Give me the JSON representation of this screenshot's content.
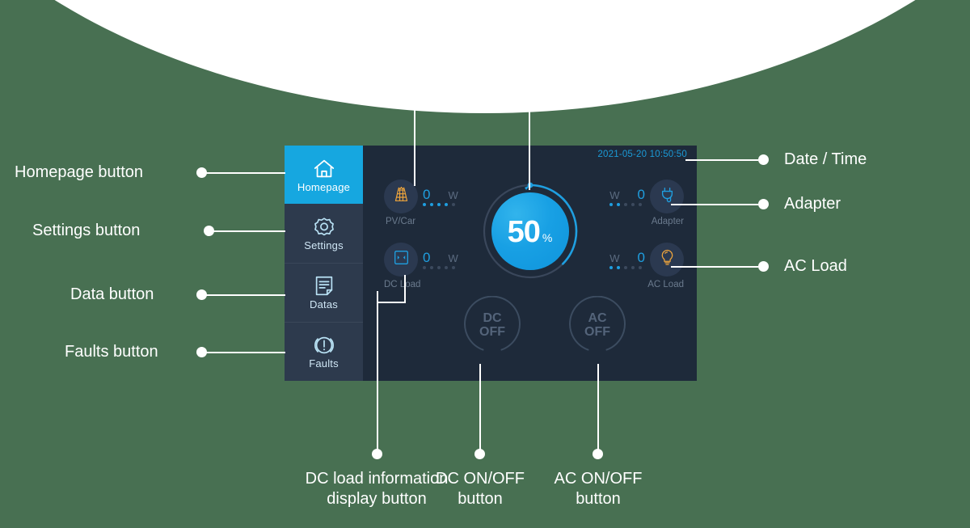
{
  "theme": {
    "background_green": "#487052",
    "panel_bg": "#1e2a3a",
    "sidebar_bg": "#2d3a4d",
    "accent_blue": "#16a7e0",
    "value_blue": "#1f9fe0",
    "icon_orange": "#f0a63c",
    "muted_text": "#6b7b8e",
    "annotation_white": "#ffffff"
  },
  "device": {
    "datetime": "2021-05-20 10:50:50",
    "sidebar": {
      "items": [
        {
          "label": "Homepage",
          "icon": "home-icon",
          "active": true
        },
        {
          "label": "Settings",
          "icon": "gear-icon",
          "active": false
        },
        {
          "label": "Datas",
          "icon": "document-icon",
          "active": false
        },
        {
          "label": "Faults",
          "icon": "alert-icon",
          "active": false
        }
      ]
    },
    "gauge": {
      "value": "50",
      "unit": "%",
      "percent": 50
    },
    "metrics": [
      {
        "id": "pv",
        "caption": "PV/Car",
        "value": "0",
        "unit": "W",
        "icon": "solar-panel-icon",
        "icon_color": "#f0a63c",
        "dots_on": 4,
        "dots_total": 5
      },
      {
        "id": "dc_load",
        "caption": "DC Load",
        "value": "0",
        "unit": "W",
        "icon": "dc-outlet-icon",
        "icon_color": "#1f9fe0",
        "dots_on": 0,
        "dots_total": 5
      },
      {
        "id": "adapter",
        "caption": "Adapter",
        "value": "0",
        "unit": "W",
        "icon": "plug-icon",
        "icon_color": "#1f9fe0",
        "dots_on": 2,
        "dots_total": 5
      },
      {
        "id": "ac_load",
        "caption": "AC Load",
        "value": "0",
        "unit": "W",
        "icon": "bulb-icon",
        "icon_color": "#f0a63c",
        "dots_on": 2,
        "dots_total": 5
      }
    ],
    "toggles": [
      {
        "id": "dc",
        "line1": "DC",
        "line2": "OFF"
      },
      {
        "id": "ac",
        "line1": "AC",
        "line2": "OFF"
      }
    ]
  },
  "annotations": {
    "left": [
      {
        "text": "Homepage button"
      },
      {
        "text": "Settings button"
      },
      {
        "text": "Data button"
      },
      {
        "text": "Faults button"
      }
    ],
    "right": [
      {
        "text": "Date / Time"
      },
      {
        "text": "Adapter"
      },
      {
        "text": "AC Load"
      }
    ],
    "bottom": [
      {
        "line1": "DC load information",
        "line2": "display button"
      },
      {
        "line1": "DC ON/OFF",
        "line2": "button"
      },
      {
        "line1": "AC ON/OFF",
        "line2": "button"
      }
    ]
  }
}
